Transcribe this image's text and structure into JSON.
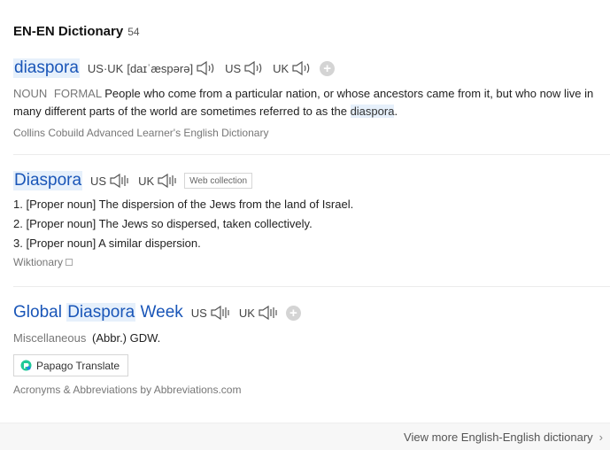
{
  "header": {
    "title": "EN-EN Dictionary",
    "count": "54"
  },
  "entry1": {
    "word": "diaspora",
    "pron_label": "US·UK",
    "pron": "[daɪˈæspərə]",
    "us": "US",
    "uk": "UK",
    "pos": "NOUN",
    "register": "FORMAL",
    "def_before": "People who come from a particular nation, or whose ancestors came from it, but who now live in many different parts of the world are sometimes referred to as the",
    "def_highlight": "diaspora",
    "def_after": ".",
    "source": "Collins Cobuild Advanced Learner's English Dictionary"
  },
  "entry2": {
    "word": "Diaspora",
    "us": "US",
    "uk": "UK",
    "tag": "Web collection",
    "defs": [
      "1. [Proper noun] The dispersion of the Jews from the land of Israel.",
      "2. [Proper noun] The Jews so dispersed, taken collectively.",
      "3. [Proper noun] A similar dispersion."
    ],
    "source": "Wiktionary"
  },
  "entry3": {
    "word_a": "Global",
    "word_b": "Diaspora",
    "word_c": "Week",
    "us": "US",
    "uk": "UK",
    "pos": "Miscellaneous",
    "def": "(Abbr.) GDW.",
    "papago_label": "Papago Translate",
    "source": "Acronyms & Abbreviations by Abbreviations.com"
  },
  "footer": {
    "view_more": "View more English-English dictionary"
  }
}
